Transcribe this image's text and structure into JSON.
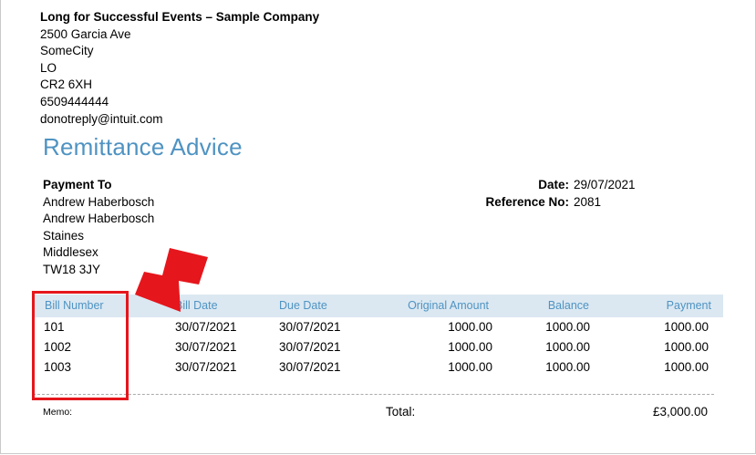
{
  "company": {
    "name": "Long for Successful Events – Sample Company",
    "lines": [
      "2500 Garcia Ave",
      "SomeCity",
      "LO",
      "CR2 6XH",
      "6509444444",
      "donotreply@intuit.com"
    ]
  },
  "title": "Remittance Advice",
  "payment_to": {
    "label": "Payment To",
    "lines": [
      "Andrew Haberbosch",
      "Andrew Haberbosch",
      "Staines",
      "Middlesex",
      "TW18 3JY"
    ]
  },
  "meta": {
    "date_label": "Date:",
    "date_value": "29/07/2021",
    "ref_label": "Reference No:",
    "ref_value": "2081"
  },
  "table": {
    "headers": [
      "Bill Number",
      "Bill Date",
      "Due Date",
      "Original Amount",
      "Balance",
      "Payment"
    ],
    "rows": [
      [
        "101",
        "30/07/2021",
        "30/07/2021",
        "1000.00",
        "1000.00",
        "1000.00"
      ],
      [
        "1002",
        "30/07/2021",
        "30/07/2021",
        "1000.00",
        "1000.00",
        "1000.00"
      ],
      [
        "1003",
        "30/07/2021",
        "30/07/2021",
        "1000.00",
        "1000.00",
        "1000.00"
      ]
    ]
  },
  "footer": {
    "memo_label": "Memo:",
    "total_label": "Total:",
    "total_value": "£3,000.00"
  },
  "annotation": {
    "color": "#e5161c"
  }
}
